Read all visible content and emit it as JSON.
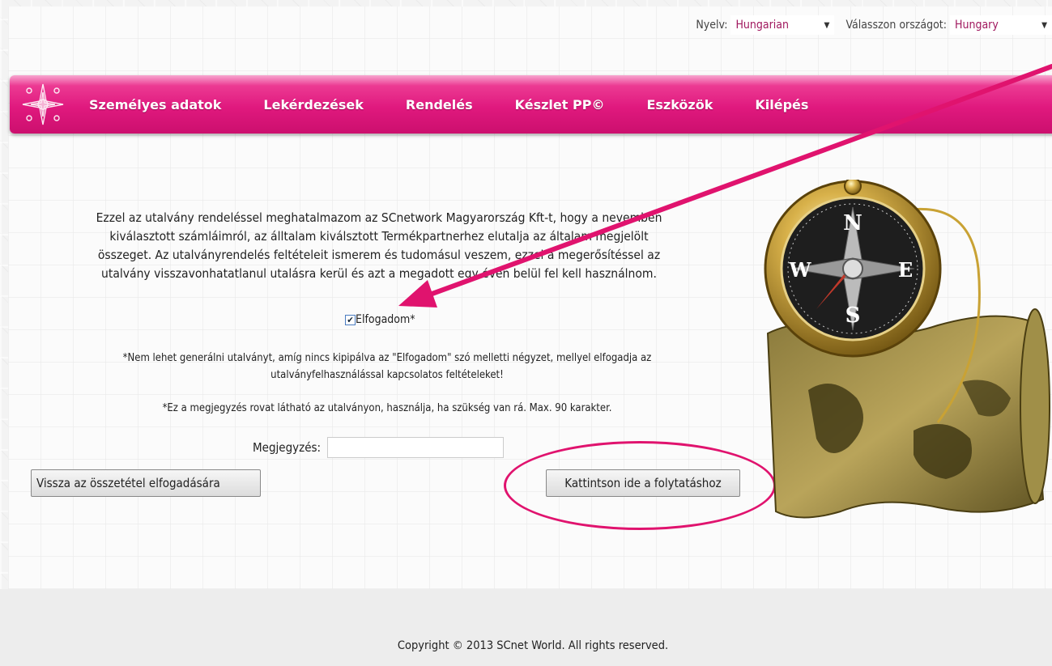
{
  "language_bar": {
    "language_label": "Nyelv:",
    "language_value": "Hungarian",
    "country_label": "Válasszon országot:",
    "country_value": "Hungary"
  },
  "nav": {
    "items": [
      "Személyes adatok",
      "Lekérdezések",
      "Rendelés",
      "Készlet PP©",
      "Eszközök",
      "Kilépés"
    ]
  },
  "main": {
    "paragraph_lines": [
      "Ezzel az utalvány rendeléssel meghatalmazom az SCnetwork Magyarország Kft-t, hogy a nevemben",
      "kiválasztott számláimról, az álltalam kiválsztott Termékpartnerhez elutalja az általam megjelölt",
      "összeget. Az utalványrendelés feltételeit ismerem és tudomásul veszem, ezzel a megerősítéssel az",
      "utalvány visszavonhatatlanul utalásra kerül és azt a megadott egy éven belül fel kell használnom."
    ],
    "accept_label": "Elfogadom*",
    "accept_checked": true,
    "note1_lines": [
      "*Nem lehet generálni utalványt, amíg nincs kipipálva az \"Elfogadom\" szó melletti négyzet, mellyel elfogadja az",
      "utalványfelhasználással kapcsolatos feltételeket!"
    ],
    "note2": "*Ez a megjegyzés rovat látható az utalványon, használja, ha szükség van rá. Max. 90 karakter.",
    "remark_label": "Megjegyzés:",
    "remark_value": "",
    "back_button": "Vissza az összetétel elfogadására",
    "continue_button": "Kattintson ide a folytatáshoz"
  },
  "footer": {
    "copyright": "Copyright © 2013 SCnet World. All rights reserved."
  },
  "colors": {
    "brand_pink": "#e0197e",
    "annotation_pink": "#e0136e"
  }
}
